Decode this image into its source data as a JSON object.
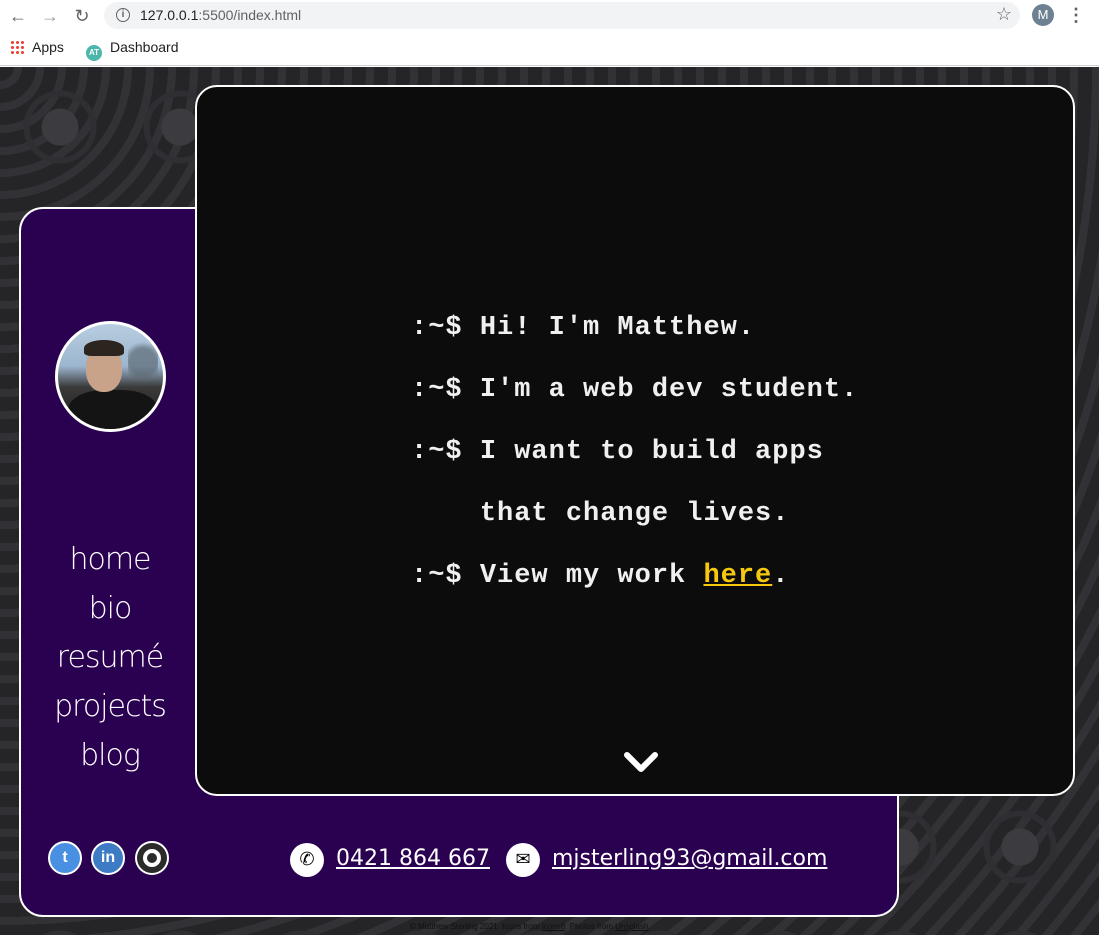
{
  "browser": {
    "url_host": "127.0.0.1",
    "url_rest": ":5500/index.html",
    "profile_initial": "M",
    "bookmarks": [
      {
        "label": "Apps",
        "icon": "apps-grid-icon"
      },
      {
        "label": "Dashboard",
        "icon": "dashboard-logo-icon"
      }
    ]
  },
  "sidebar": {
    "nav": [
      "home",
      "bio",
      "resumé",
      "projects",
      "blog"
    ]
  },
  "terminal": {
    "prompt": ":~$",
    "lines": [
      {
        "prompt": ":~$",
        "text": "Hi! I'm Matthew."
      },
      {
        "prompt": ":~$",
        "text": "I'm a web dev student."
      },
      {
        "prompt": ":~$",
        "text": "I want to build apps"
      },
      {
        "prompt": "",
        "text": "that change lives."
      },
      {
        "prompt": ":~$",
        "text": "View my work ",
        "link": "here",
        "after": "."
      }
    ]
  },
  "socials": [
    {
      "name": "twitter",
      "icon": "twitter-icon"
    },
    {
      "name": "linkedin",
      "icon": "linkedin-icon"
    },
    {
      "name": "github",
      "icon": "github-icon"
    }
  ],
  "contact": {
    "phone": "0421 864 667",
    "email": "mjsterling93@gmail.com"
  },
  "footer": {
    "text1": "© Matthew Sterling 2021. Icons from ",
    "link1": "Icons8",
    "text2": ". Photos from ",
    "link2": "Unsplash",
    "text3": "."
  },
  "colors": {
    "purple": "#2a0050",
    "terminal_bg": "#0c0c0c",
    "link_yellow": "#f6c90e"
  }
}
